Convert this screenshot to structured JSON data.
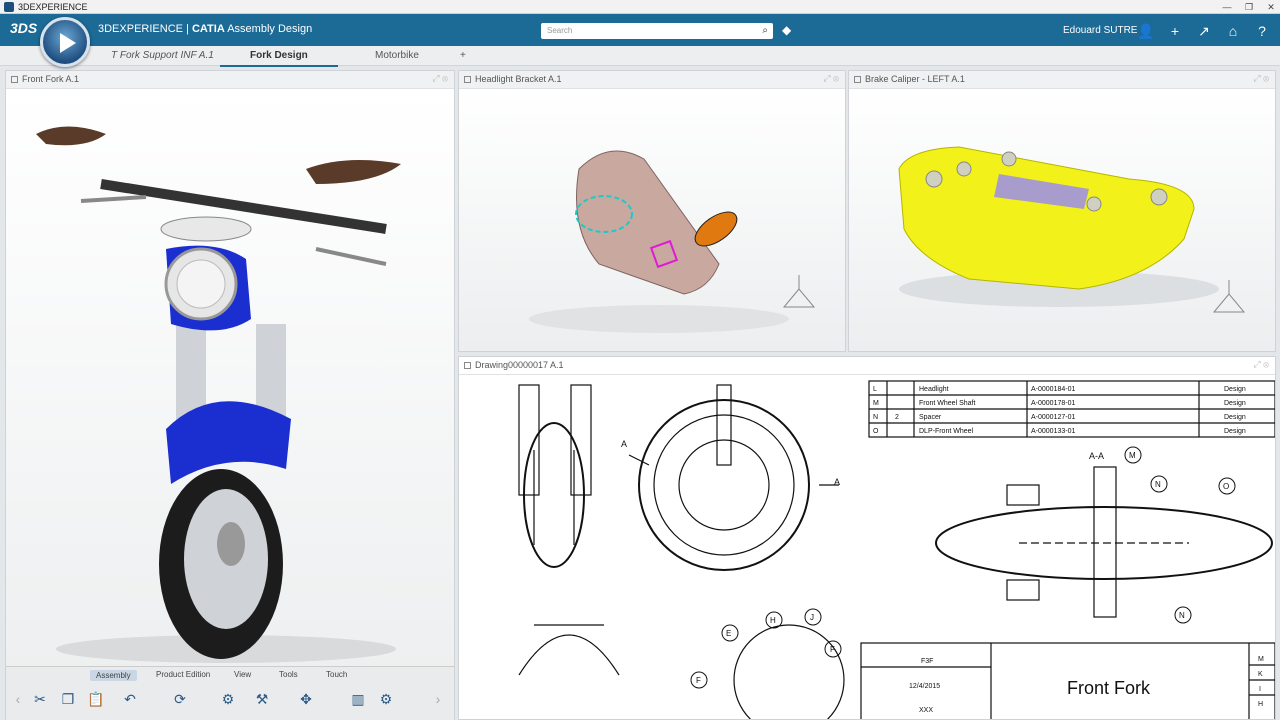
{
  "window": {
    "title": "3DEXPERIENCE",
    "controls": [
      "—",
      "❐",
      "✕"
    ]
  },
  "header": {
    "brand": "3DEXPERIENCE",
    "separator": " | ",
    "product": "CATIA",
    "app": "Assembly Design",
    "search_placeholder": "Search",
    "user": "Edouard SUTRE"
  },
  "tabs": [
    {
      "label": "T Fork Support INF A.1",
      "active": false
    },
    {
      "label": "Fork Design",
      "active": true
    },
    {
      "label": "Motorbike",
      "active": false
    },
    {
      "label": "+",
      "active": false
    }
  ],
  "panels": {
    "front_fork": "Front Fork A.1",
    "headlight": "Headlight Bracket A.1",
    "caliper": "Brake Caliper - LEFT A.1",
    "drawing": "Drawing00000017 A.1"
  },
  "drawing": {
    "bom": [
      [
        "L",
        "",
        "Headlight",
        "A-0000184-01",
        "Design"
      ],
      [
        "M",
        "",
        "Front Wheel Shaft",
        "A-0000178-01",
        "Design"
      ],
      [
        "N",
        "2",
        "Spacer",
        "A-0000127-01",
        "Design"
      ],
      [
        "O",
        "",
        "DLP-Front Wheel",
        "A-0000133-01",
        "Design"
      ]
    ],
    "section_label": "A-A",
    "view_marker": "A",
    "callouts": [
      "M",
      "N",
      "O",
      "N",
      "E",
      "H",
      "J",
      "F",
      "F"
    ],
    "title_block": {
      "name": "Front Fork",
      "ref": "F3F",
      "date": "12/4/2015",
      "drawn": "XXX",
      "rev_letters": [
        "M",
        "K",
        "I",
        "H"
      ]
    }
  },
  "toolbar": {
    "sections": [
      "Assembly",
      "Product Edition",
      "View",
      "Tools",
      "Touch"
    ],
    "active_section": "Assembly"
  },
  "colors": {
    "header": "#1c6a96",
    "caliper": "#f2f21a",
    "fender": "#1b2fd0"
  }
}
